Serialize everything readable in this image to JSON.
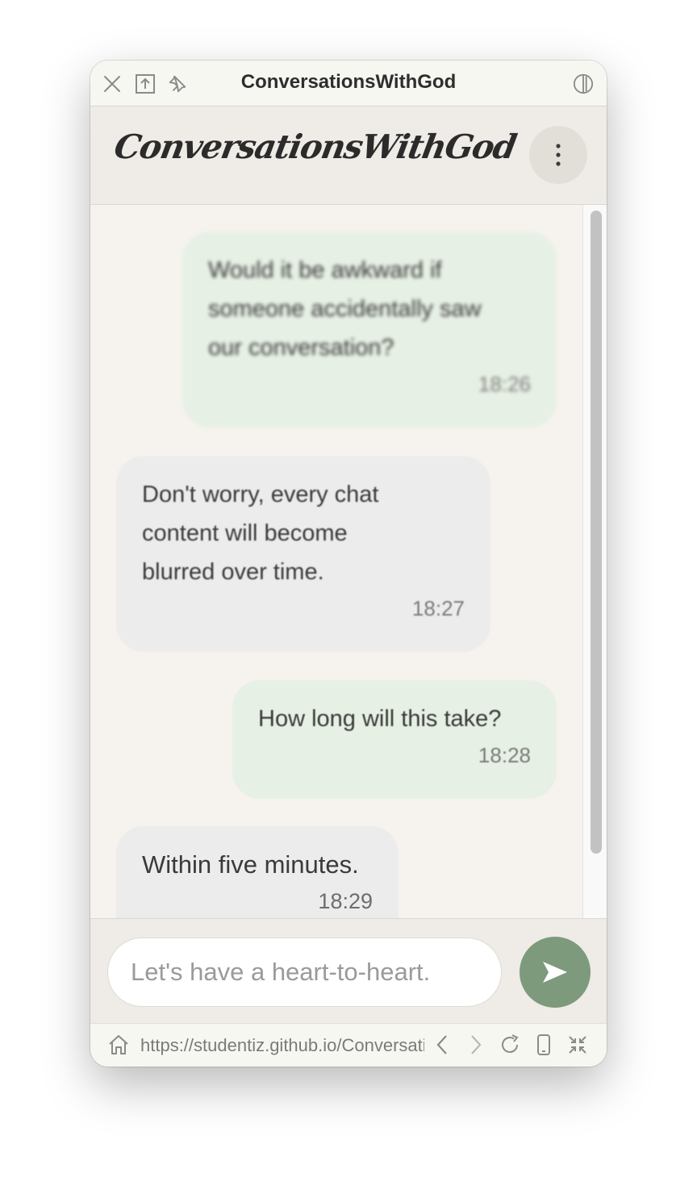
{
  "window": {
    "title": "ConversationsWithGod"
  },
  "titlebar": {
    "icons": [
      "close-icon",
      "share-icon",
      "pin-icon",
      "appearance-icon"
    ]
  },
  "header": {
    "brand": "ConversationsWithGod",
    "menu_icon": "more-vertical-icon"
  },
  "messages": [
    {
      "sender": "user",
      "text": "Would it be awkward if\nsomeone accidentally saw\nour conversation?",
      "time": "18:26"
    },
    {
      "sender": "god",
      "text": "Don't worry, every chat\ncontent will become\nblurred over time.",
      "time": "18:27"
    },
    {
      "sender": "user",
      "text": "How long will this take?",
      "time": "18:28"
    },
    {
      "sender": "god",
      "text": "Within five minutes.",
      "time": "18:29"
    }
  ],
  "composer": {
    "placeholder": "Let's have a heart-to-heart.",
    "value": "",
    "send_icon": "send-icon"
  },
  "urlbar": {
    "url": "https://studentiz.github.io/ConversationsWithGod",
    "icons": [
      "home-icon",
      "back-icon",
      "forward-icon",
      "reload-icon",
      "device-icon",
      "collapse-icon"
    ]
  },
  "colors": {
    "accent": "#7d9a7d",
    "user_bubble": "#e6f0e4",
    "god_bubble": "#ececec",
    "background": "#f6f3ef"
  }
}
